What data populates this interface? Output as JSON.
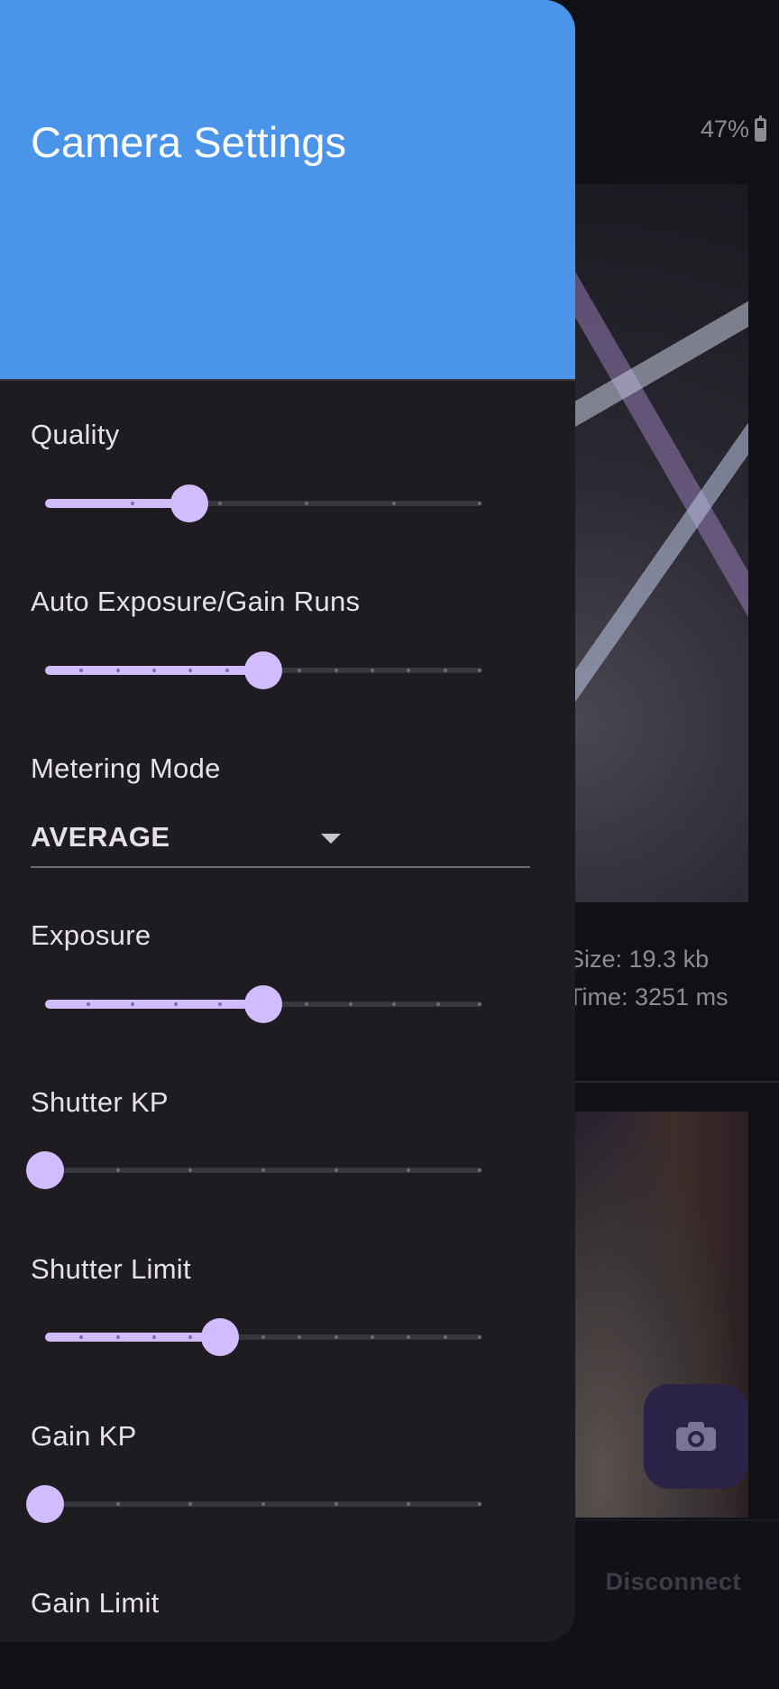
{
  "status": {
    "battery": "47%"
  },
  "background": {
    "photo1_size": "Size: 19.3 kb",
    "photo1_time": "Time: 3251 ms",
    "disconnect_label": "Disconnect"
  },
  "drawer": {
    "title": "Camera Settings",
    "quality": {
      "label": "Quality",
      "value": 0.33,
      "ticks": 4
    },
    "ae_runs": {
      "label": "Auto Exposure/Gain Runs",
      "value": 0.5,
      "ticks": 11
    },
    "metering": {
      "label": "Metering Mode",
      "value": "AVERAGE"
    },
    "exposure": {
      "label": "Exposure",
      "value": 0.5,
      "ticks": 9
    },
    "shutter_kp": {
      "label": "Shutter KP",
      "value": 0.0,
      "ticks": 5
    },
    "shutter_limit": {
      "label": "Shutter Limit",
      "value": 0.4,
      "ticks": 11
    },
    "gain_kp": {
      "label": "Gain KP",
      "value": 0.0,
      "ticks": 5
    },
    "gain_limit": {
      "label": "Gain Limit"
    }
  },
  "colors": {
    "accent": "#d0bcff",
    "header": "#4a94ea",
    "drawer_bg": "#1e1c21"
  }
}
